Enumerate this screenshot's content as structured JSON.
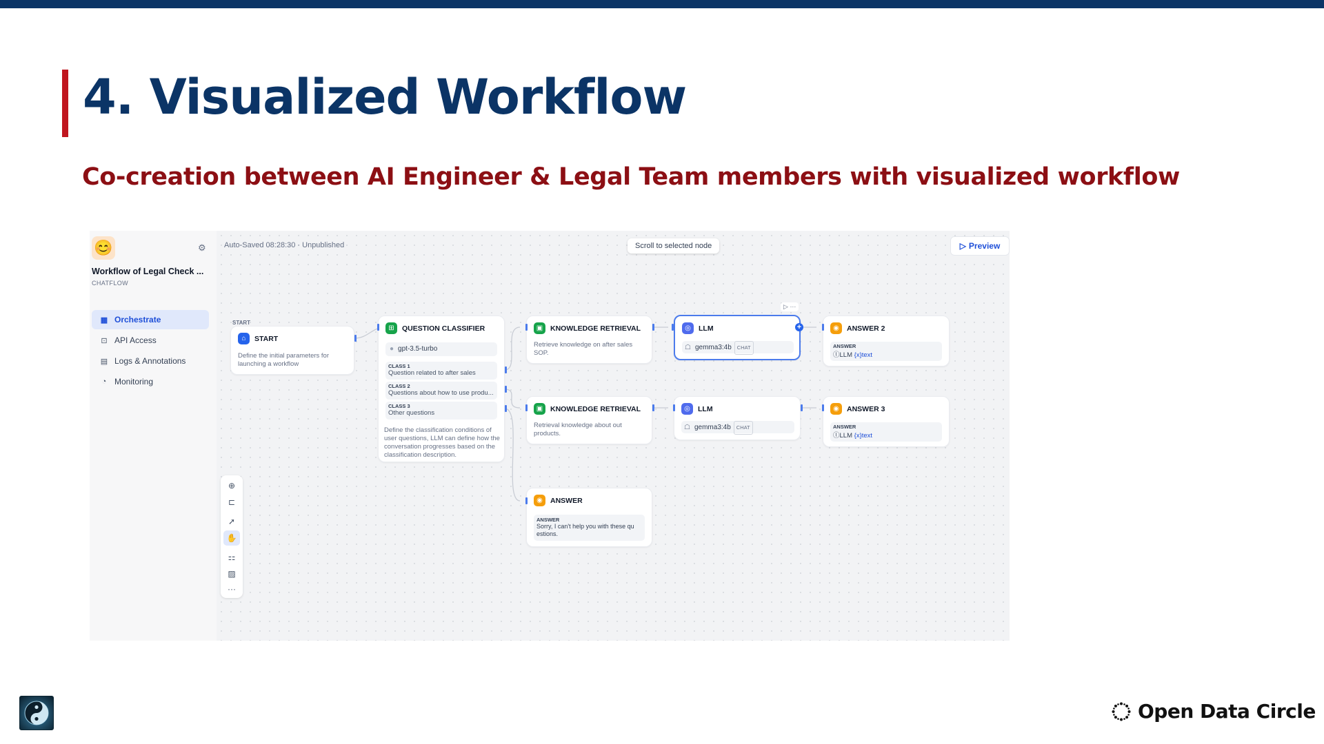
{
  "slide": {
    "title": "4. Visualized Workflow",
    "subtitle": "Co-creation between  AI Engineer & Legal Team members with visualized workflow",
    "brand": "Open Data Circle",
    "colors": {
      "title": "#0b3466",
      "subtitle": "#8c0f14",
      "accent_bar": "#c0161f",
      "top_bar": "#0b3466"
    }
  },
  "app": {
    "icon": "face-emoji-icon",
    "workflow_title": "Workflow of Legal Check ...",
    "workflow_type": "CHATFLOW",
    "nav": [
      {
        "label": "Orchestrate",
        "icon": "orchestrate-icon",
        "active": true
      },
      {
        "label": "API Access",
        "icon": "terminal-icon",
        "active": false
      },
      {
        "label": "Logs & Annotations",
        "icon": "document-icon",
        "active": false
      },
      {
        "label": "Monitoring",
        "icon": "gauge-icon",
        "active": false
      }
    ]
  },
  "canvas": {
    "autosave": "Auto-Saved 08:28:30 · Unpublished",
    "scroll_button": "Scroll to selected node",
    "preview_button": "Preview",
    "start_tag": "START",
    "nodes": {
      "start": {
        "title": "START",
        "desc": "Define the initial parameters for launching a workflow",
        "color": "#2563eb"
      },
      "classifier": {
        "title": "QUESTION CLASSIFIER",
        "model": "gpt-3.5-turbo",
        "classes": [
          {
            "label": "CLASS 1",
            "text": "Question related to after sales"
          },
          {
            "label": "CLASS 2",
            "text": "Questions about how to use produ..."
          },
          {
            "label": "CLASS 3",
            "text": "Other questions"
          }
        ],
        "desc": "Define the classification conditions of user questions, LLM can define how the conversation progresses based on the classification description.",
        "color": "#16a34a"
      },
      "kr1": {
        "title": "KNOWLEDGE RETRIEVAL",
        "desc": "Retrieve knowledge on after sales SOP.",
        "color": "#16a34a"
      },
      "kr2": {
        "title": "KNOWLEDGE RETRIEVAL",
        "desc": "Retrieval knowledge about out products.",
        "color": "#16a34a"
      },
      "llm1": {
        "title": "LLM",
        "model": "gemma3:4b",
        "tag": "CHAT",
        "color": "#4f6bed"
      },
      "llm2": {
        "title": "LLM",
        "model": "gemma3:4b",
        "tag": "CHAT",
        "color": "#4f6bed"
      },
      "answer2": {
        "title": "ANSWER 2",
        "label": "ANSWER",
        "var_prefix": "LLM",
        "var_name": "text",
        "color": "#f59e0b"
      },
      "answer3": {
        "title": "ANSWER 3",
        "label": "ANSWER",
        "var_prefix": "LLM",
        "var_name": "text",
        "color": "#f59e0b"
      },
      "answer": {
        "title": "ANSWER",
        "label": "ANSWER",
        "text": "Sorry, I can't help you with these qu estions.",
        "color": "#f59e0b"
      }
    },
    "toolbar": [
      "add-node-icon",
      "add-note-icon",
      "pointer-icon",
      "hand-icon",
      "organize-icon",
      "minimap-icon",
      "more-icon"
    ]
  }
}
